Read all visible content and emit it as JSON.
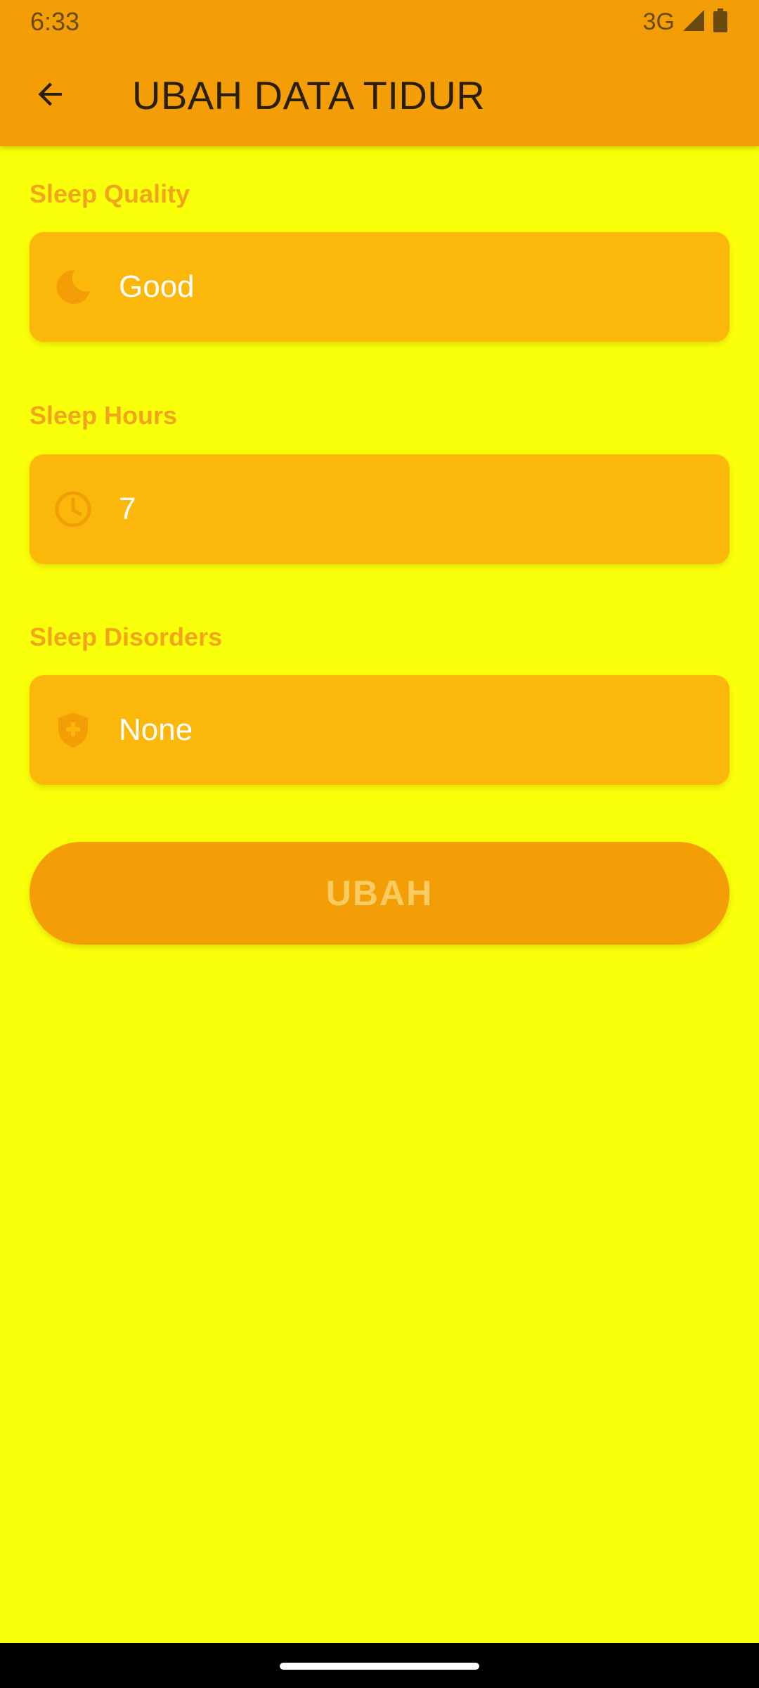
{
  "status_bar": {
    "time": "6:33",
    "network": "3G"
  },
  "app_bar": {
    "title": "UBAH DATA TIDUR",
    "back_icon": "arrow-back-icon"
  },
  "form": {
    "sleep_quality": {
      "label": "Sleep Quality",
      "value": "Good",
      "icon": "moon-icon"
    },
    "sleep_hours": {
      "label": "Sleep Hours",
      "value": "7",
      "icon": "clock-icon"
    },
    "sleep_disorders": {
      "label": "Sleep Disorders",
      "value": "None",
      "icon": "medical-shield-icon"
    }
  },
  "submit": {
    "label": "UBAH"
  },
  "colors": {
    "background": "#FAFF0A",
    "app_bar": "#F39E07",
    "field": "#FBB80B",
    "label": "#F0A51B",
    "button": "#F39E07"
  }
}
